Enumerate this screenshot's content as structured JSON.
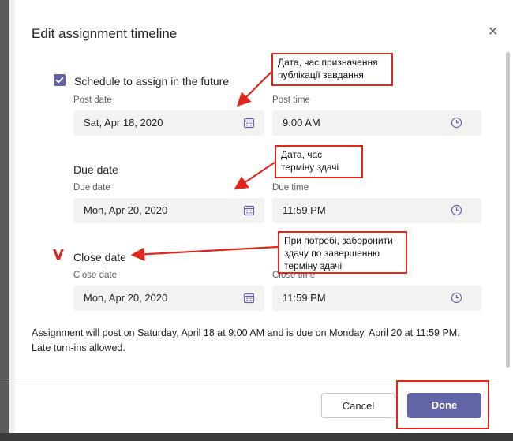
{
  "dialog": {
    "title": "Edit assignment timeline",
    "close_icon": "close-icon",
    "accent_color": "#6264a7"
  },
  "schedule": {
    "checkbox_checked": true,
    "label": "Schedule to assign in the future",
    "post_date_label": "Post date",
    "post_date_value": "Sat, Apr 18, 2020",
    "post_time_label": "Post time",
    "post_time_value": "9:00 AM"
  },
  "due": {
    "section_label": "Due date",
    "due_date_label": "Due date",
    "due_date_value": "Mon, Apr 20, 2020",
    "due_time_label": "Due time",
    "due_time_value": "11:59 PM"
  },
  "close": {
    "section_label": "Close date",
    "close_date_label": "Close date",
    "close_date_value": "Mon, Apr 20, 2020",
    "close_time_label": "Close time",
    "close_time_value": "11:59 PM",
    "mark": "V"
  },
  "info_text": "Assignment will post on Saturday, April 18 at 9:00 AM and is due on Monday, April 20 at 11:59 PM. Late turn-ins allowed.",
  "buttons": {
    "cancel": "Cancel",
    "done": "Done"
  },
  "annotations": {
    "callout1": [
      "Дата, час призначення",
      "публікації завдання"
    ],
    "callout2": [
      "Дата, час",
      "терміну здачі"
    ],
    "callout3": [
      "При потребі, заборонити",
      "здачу по завершенню",
      "терміну здачі"
    ],
    "color": "#e2261c"
  }
}
